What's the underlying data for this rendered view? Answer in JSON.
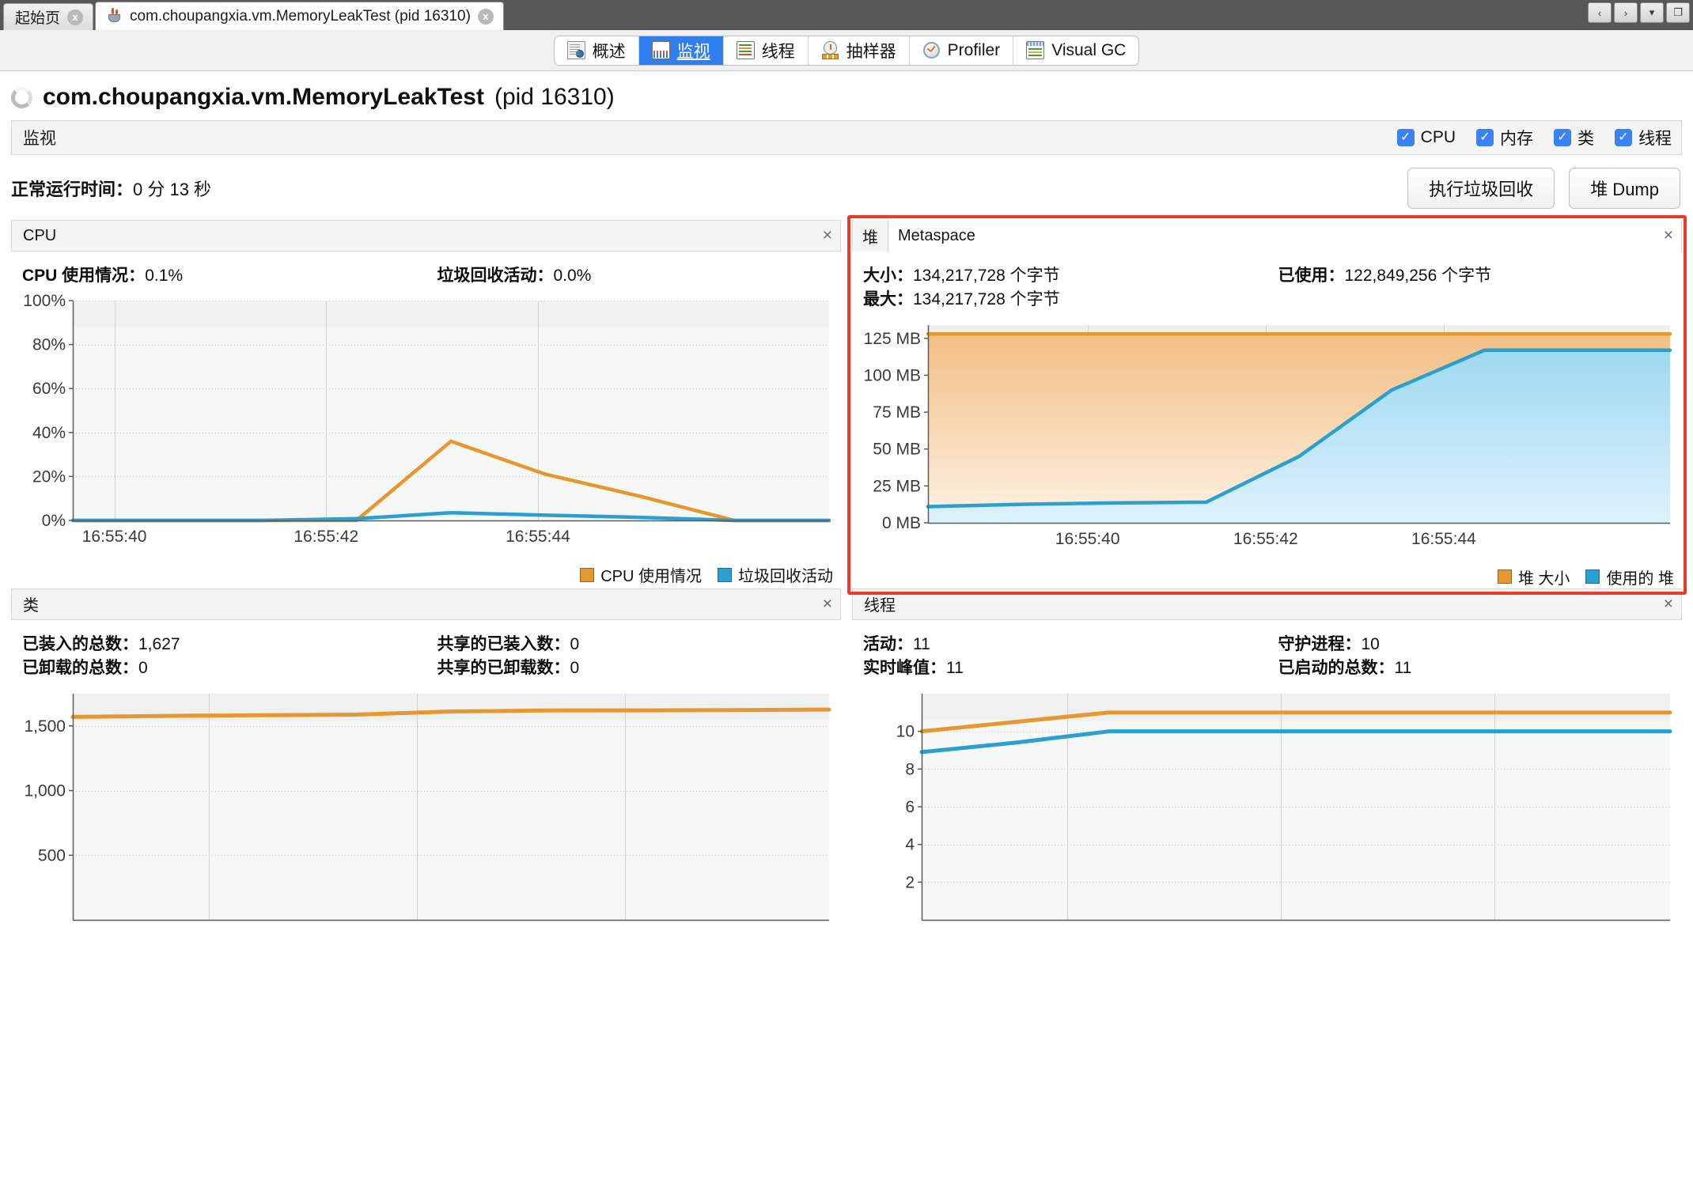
{
  "window": {
    "tabs": [
      {
        "label": "起始页",
        "icon": "none",
        "active": false,
        "close": "x"
      },
      {
        "label": "com.choupangxia.vm.MemoryLeakTest (pid 16310)",
        "icon": "java-cup-icon",
        "active": true,
        "close": "x"
      }
    ],
    "controls": [
      "‹",
      "›",
      "▾",
      "❐"
    ]
  },
  "view_tabs": [
    {
      "label": "概述",
      "icon": "overview-icon",
      "selected": false
    },
    {
      "label": "监视",
      "icon": "monitor-icon",
      "selected": true
    },
    {
      "label": "线程",
      "icon": "threads-icon",
      "selected": false
    },
    {
      "label": "抽样器",
      "icon": "sampler-icon",
      "selected": false
    },
    {
      "label": "Profiler",
      "icon": "profiler-icon",
      "selected": false
    },
    {
      "label": "Visual GC",
      "icon": "visualgc-icon",
      "selected": false
    }
  ],
  "header": {
    "title_main": "com.choupangxia.vm.MemoryLeakTest",
    "title_suffix": "(pid 16310)"
  },
  "monitor_bar": {
    "title": "监视",
    "checkboxes": [
      {
        "label": "CPU",
        "checked": true
      },
      {
        "label": "内存",
        "checked": true
      },
      {
        "label": "类",
        "checked": true
      },
      {
        "label": "线程",
        "checked": true
      }
    ],
    "check_glyph": "✓"
  },
  "uptime": {
    "label": "正常运行时间：",
    "value": "0 分 13 秒"
  },
  "buttons": {
    "gc": "执行垃圾回收",
    "heap_dump": "堆 Dump"
  },
  "panels": {
    "cpu": {
      "title": "CPU",
      "close": "×",
      "stats": [
        {
          "label": "CPU 使用情况：",
          "value": "0.1%"
        },
        {
          "label": "垃圾回收活动：",
          "value": "0.0%"
        }
      ]
    },
    "heap": {
      "tab_selected": "堆",
      "tab_other": "Metaspace",
      "close": "×",
      "stats": [
        {
          "label": "大小：",
          "value": "134,217,728 个字节"
        },
        {
          "label": "已使用：",
          "value": "122,849,256 个字节"
        },
        {
          "label": "最大：",
          "value": "134,217,728 个字节"
        }
      ]
    },
    "classes": {
      "title": "类",
      "close": "×",
      "stats": [
        {
          "label": "已装入的总数：",
          "value": "1,627"
        },
        {
          "label": "共享的已装入数：",
          "value": "0"
        },
        {
          "label": "已卸载的总数：",
          "value": "0"
        },
        {
          "label": "共享的已卸载数：",
          "value": "0"
        }
      ]
    },
    "threads": {
      "title": "线程",
      "close": "×",
      "stats": [
        {
          "label": "活动：",
          "value": "11"
        },
        {
          "label": "守护进程：",
          "value": "10"
        },
        {
          "label": "实时峰值：",
          "value": "11"
        },
        {
          "label": "已启动的总数：",
          "value": "11"
        }
      ]
    }
  },
  "colors": {
    "orange": "#E8972E",
    "blue": "#2BA0D0",
    "orange_fill": "#F6C98E",
    "blue_fill": "#BDE4F5",
    "accent_red": "#EF3A23",
    "tab_blue": "#2F7FF0"
  },
  "chart_data": [
    {
      "id": "cpu-chart",
      "type": "line",
      "title": "CPU",
      "xlabel": "",
      "ylabel": "",
      "ylim": [
        0,
        100
      ],
      "yticks": [
        0,
        20,
        40,
        60,
        80,
        100
      ],
      "ytick_labels": [
        "0%",
        "20%",
        "40%",
        "60%",
        "80%",
        "100%"
      ],
      "xticks": [
        "16:55:40",
        "16:55:42",
        "16:55:44"
      ],
      "grid": true,
      "legend_position": "bottom-right",
      "x": [
        0,
        1,
        2,
        3,
        4,
        5,
        6,
        7,
        8
      ],
      "series": [
        {
          "name": "CPU 使用情况",
          "color": "#E8972E",
          "values": [
            0,
            0,
            0,
            0,
            36,
            21,
            11,
            0,
            0
          ]
        },
        {
          "name": "垃圾回收活动",
          "color": "#2BA0D0",
          "values": [
            0,
            0,
            0,
            0.8,
            3.5,
            2.4,
            1.4,
            0,
            0
          ]
        }
      ]
    },
    {
      "id": "heap-chart",
      "type": "area",
      "title": "堆",
      "xlabel": "",
      "ylabel": "",
      "ylim": [
        0,
        134
      ],
      "yticks": [
        0,
        25,
        50,
        75,
        100,
        125
      ],
      "ytick_labels": [
        "0 MB",
        "25 MB",
        "50 MB",
        "75 MB",
        "100 MB",
        "125 MB"
      ],
      "xticks": [
        "16:55:40",
        "16:55:42",
        "16:55:44"
      ],
      "grid": true,
      "legend_position": "bottom-right",
      "x": [
        0,
        1,
        2,
        3,
        4,
        5,
        6,
        7,
        8
      ],
      "series": [
        {
          "name": "堆 大小",
          "color": "#E8972E",
          "values": [
            128,
            128,
            128,
            128,
            128,
            128,
            128,
            128,
            128
          ]
        },
        {
          "name": "使用的 堆",
          "color": "#2BA0D0",
          "values": [
            11,
            12.5,
            13.5,
            14,
            45,
            90,
            117,
            117,
            117
          ]
        }
      ]
    },
    {
      "id": "classes-chart",
      "type": "line",
      "title": "类",
      "xlabel": "",
      "ylabel": "",
      "ylim": [
        0,
        1750
      ],
      "yticks": [
        500,
        1000,
        1500
      ],
      "ytick_labels": [
        "500",
        "1,000",
        "1,500"
      ],
      "xticks": [],
      "grid": true,
      "legend_position": "none",
      "x": [
        0,
        1,
        2,
        3,
        4,
        5,
        6,
        7,
        8
      ],
      "series": [
        {
          "name": "已装入的总数",
          "color": "#E8972E",
          "values": [
            1570,
            1578,
            1583,
            1588,
            1612,
            1620,
            1621,
            1623,
            1627
          ]
        }
      ]
    },
    {
      "id": "threads-chart",
      "type": "line",
      "title": "线程",
      "xlabel": "",
      "ylabel": "",
      "ylim": [
        0,
        12
      ],
      "yticks": [
        2,
        4,
        6,
        8,
        10
      ],
      "ytick_labels": [
        "2",
        "4",
        "6",
        "8",
        "10"
      ],
      "xticks": [],
      "grid": true,
      "legend_position": "none",
      "x": [
        0,
        1,
        2,
        3,
        4,
        5,
        6,
        7,
        8
      ],
      "series": [
        {
          "name": "活动",
          "color": "#E8972E",
          "values": [
            10,
            10.5,
            11,
            11,
            11,
            11,
            11,
            11,
            11
          ]
        },
        {
          "name": "守护进程",
          "color": "#2BA0D0",
          "values": [
            8.9,
            9.4,
            10,
            10,
            10,
            10,
            10,
            10,
            10
          ]
        }
      ]
    }
  ]
}
